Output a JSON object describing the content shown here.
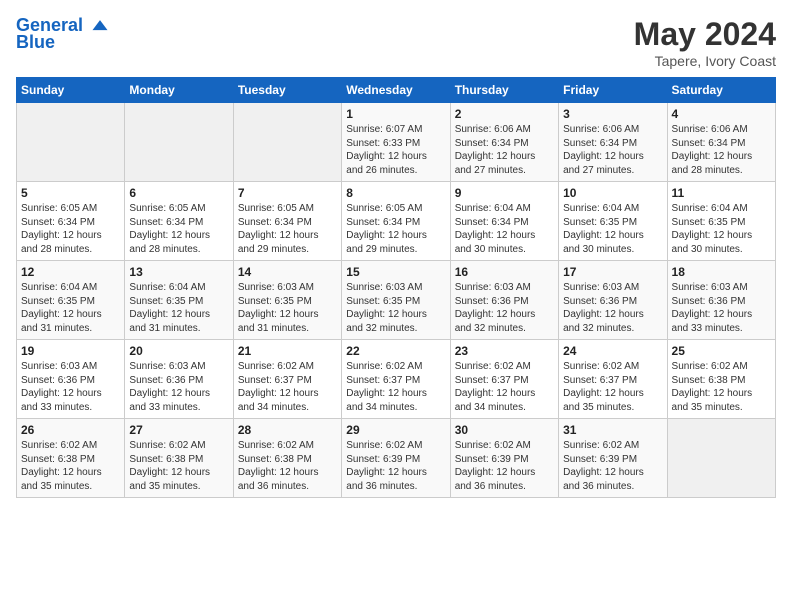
{
  "header": {
    "logo_line1": "General",
    "logo_line2": "Blue",
    "month_year": "May 2024",
    "location": "Tapere, Ivory Coast"
  },
  "weekdays": [
    "Sunday",
    "Monday",
    "Tuesday",
    "Wednesday",
    "Thursday",
    "Friday",
    "Saturday"
  ],
  "weeks": [
    [
      {
        "day": "",
        "sunrise": "",
        "sunset": "",
        "daylight": ""
      },
      {
        "day": "",
        "sunrise": "",
        "sunset": "",
        "daylight": ""
      },
      {
        "day": "",
        "sunrise": "",
        "sunset": "",
        "daylight": ""
      },
      {
        "day": "1",
        "sunrise": "Sunrise: 6:07 AM",
        "sunset": "Sunset: 6:33 PM",
        "daylight": "Daylight: 12 hours and 26 minutes."
      },
      {
        "day": "2",
        "sunrise": "Sunrise: 6:06 AM",
        "sunset": "Sunset: 6:34 PM",
        "daylight": "Daylight: 12 hours and 27 minutes."
      },
      {
        "day": "3",
        "sunrise": "Sunrise: 6:06 AM",
        "sunset": "Sunset: 6:34 PM",
        "daylight": "Daylight: 12 hours and 27 minutes."
      },
      {
        "day": "4",
        "sunrise": "Sunrise: 6:06 AM",
        "sunset": "Sunset: 6:34 PM",
        "daylight": "Daylight: 12 hours and 28 minutes."
      }
    ],
    [
      {
        "day": "5",
        "sunrise": "Sunrise: 6:05 AM",
        "sunset": "Sunset: 6:34 PM",
        "daylight": "Daylight: 12 hours and 28 minutes."
      },
      {
        "day": "6",
        "sunrise": "Sunrise: 6:05 AM",
        "sunset": "Sunset: 6:34 PM",
        "daylight": "Daylight: 12 hours and 28 minutes."
      },
      {
        "day": "7",
        "sunrise": "Sunrise: 6:05 AM",
        "sunset": "Sunset: 6:34 PM",
        "daylight": "Daylight: 12 hours and 29 minutes."
      },
      {
        "day": "8",
        "sunrise": "Sunrise: 6:05 AM",
        "sunset": "Sunset: 6:34 PM",
        "daylight": "Daylight: 12 hours and 29 minutes."
      },
      {
        "day": "9",
        "sunrise": "Sunrise: 6:04 AM",
        "sunset": "Sunset: 6:34 PM",
        "daylight": "Daylight: 12 hours and 30 minutes."
      },
      {
        "day": "10",
        "sunrise": "Sunrise: 6:04 AM",
        "sunset": "Sunset: 6:35 PM",
        "daylight": "Daylight: 12 hours and 30 minutes."
      },
      {
        "day": "11",
        "sunrise": "Sunrise: 6:04 AM",
        "sunset": "Sunset: 6:35 PM",
        "daylight": "Daylight: 12 hours and 30 minutes."
      }
    ],
    [
      {
        "day": "12",
        "sunrise": "Sunrise: 6:04 AM",
        "sunset": "Sunset: 6:35 PM",
        "daylight": "Daylight: 12 hours and 31 minutes."
      },
      {
        "day": "13",
        "sunrise": "Sunrise: 6:04 AM",
        "sunset": "Sunset: 6:35 PM",
        "daylight": "Daylight: 12 hours and 31 minutes."
      },
      {
        "day": "14",
        "sunrise": "Sunrise: 6:03 AM",
        "sunset": "Sunset: 6:35 PM",
        "daylight": "Daylight: 12 hours and 31 minutes."
      },
      {
        "day": "15",
        "sunrise": "Sunrise: 6:03 AM",
        "sunset": "Sunset: 6:35 PM",
        "daylight": "Daylight: 12 hours and 32 minutes."
      },
      {
        "day": "16",
        "sunrise": "Sunrise: 6:03 AM",
        "sunset": "Sunset: 6:36 PM",
        "daylight": "Daylight: 12 hours and 32 minutes."
      },
      {
        "day": "17",
        "sunrise": "Sunrise: 6:03 AM",
        "sunset": "Sunset: 6:36 PM",
        "daylight": "Daylight: 12 hours and 32 minutes."
      },
      {
        "day": "18",
        "sunrise": "Sunrise: 6:03 AM",
        "sunset": "Sunset: 6:36 PM",
        "daylight": "Daylight: 12 hours and 33 minutes."
      }
    ],
    [
      {
        "day": "19",
        "sunrise": "Sunrise: 6:03 AM",
        "sunset": "Sunset: 6:36 PM",
        "daylight": "Daylight: 12 hours and 33 minutes."
      },
      {
        "day": "20",
        "sunrise": "Sunrise: 6:03 AM",
        "sunset": "Sunset: 6:36 PM",
        "daylight": "Daylight: 12 hours and 33 minutes."
      },
      {
        "day": "21",
        "sunrise": "Sunrise: 6:02 AM",
        "sunset": "Sunset: 6:37 PM",
        "daylight": "Daylight: 12 hours and 34 minutes."
      },
      {
        "day": "22",
        "sunrise": "Sunrise: 6:02 AM",
        "sunset": "Sunset: 6:37 PM",
        "daylight": "Daylight: 12 hours and 34 minutes."
      },
      {
        "day": "23",
        "sunrise": "Sunrise: 6:02 AM",
        "sunset": "Sunset: 6:37 PM",
        "daylight": "Daylight: 12 hours and 34 minutes."
      },
      {
        "day": "24",
        "sunrise": "Sunrise: 6:02 AM",
        "sunset": "Sunset: 6:37 PM",
        "daylight": "Daylight: 12 hours and 35 minutes."
      },
      {
        "day": "25",
        "sunrise": "Sunrise: 6:02 AM",
        "sunset": "Sunset: 6:38 PM",
        "daylight": "Daylight: 12 hours and 35 minutes."
      }
    ],
    [
      {
        "day": "26",
        "sunrise": "Sunrise: 6:02 AM",
        "sunset": "Sunset: 6:38 PM",
        "daylight": "Daylight: 12 hours and 35 minutes."
      },
      {
        "day": "27",
        "sunrise": "Sunrise: 6:02 AM",
        "sunset": "Sunset: 6:38 PM",
        "daylight": "Daylight: 12 hours and 35 minutes."
      },
      {
        "day": "28",
        "sunrise": "Sunrise: 6:02 AM",
        "sunset": "Sunset: 6:38 PM",
        "daylight": "Daylight: 12 hours and 36 minutes."
      },
      {
        "day": "29",
        "sunrise": "Sunrise: 6:02 AM",
        "sunset": "Sunset: 6:39 PM",
        "daylight": "Daylight: 12 hours and 36 minutes."
      },
      {
        "day": "30",
        "sunrise": "Sunrise: 6:02 AM",
        "sunset": "Sunset: 6:39 PM",
        "daylight": "Daylight: 12 hours and 36 minutes."
      },
      {
        "day": "31",
        "sunrise": "Sunrise: 6:02 AM",
        "sunset": "Sunset: 6:39 PM",
        "daylight": "Daylight: 12 hours and 36 minutes."
      },
      {
        "day": "",
        "sunrise": "",
        "sunset": "",
        "daylight": ""
      }
    ]
  ]
}
